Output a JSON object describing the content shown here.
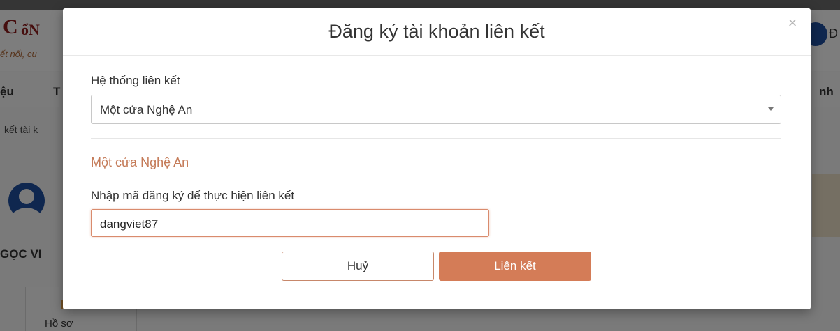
{
  "background": {
    "logo_c": "C",
    "logo_on": "ổN",
    "tagline": "ết nối, cu",
    "header_right": "Đ",
    "nav_left_1": "ệu",
    "nav_left_2": "T",
    "nav_right": "nh",
    "breadcrumb": "kết tài k",
    "profile_name": "GỌC VI",
    "sidebar_item": "Hồ sơ"
  },
  "modal": {
    "title": "Đăng ký tài khoản liên kết",
    "close_symbol": "×",
    "system_label": "Hệ thống liên kết",
    "system_selected": "Một cửa Nghệ An",
    "section_title": "Một cửa Nghệ An",
    "code_label": "Nhập mã đăng ký để thực hiện liên kết",
    "code_value": "dangviet87",
    "cancel_label": "Huỷ",
    "link_label": "Liên kết"
  },
  "colors": {
    "accent": "#d47c57",
    "section_title": "#c47a57",
    "brand_red": "#8c1d1d"
  },
  "icons": {
    "close": "close-icon",
    "dropdown": "chevron-down-icon",
    "profile": "user-avatar-icon"
  }
}
